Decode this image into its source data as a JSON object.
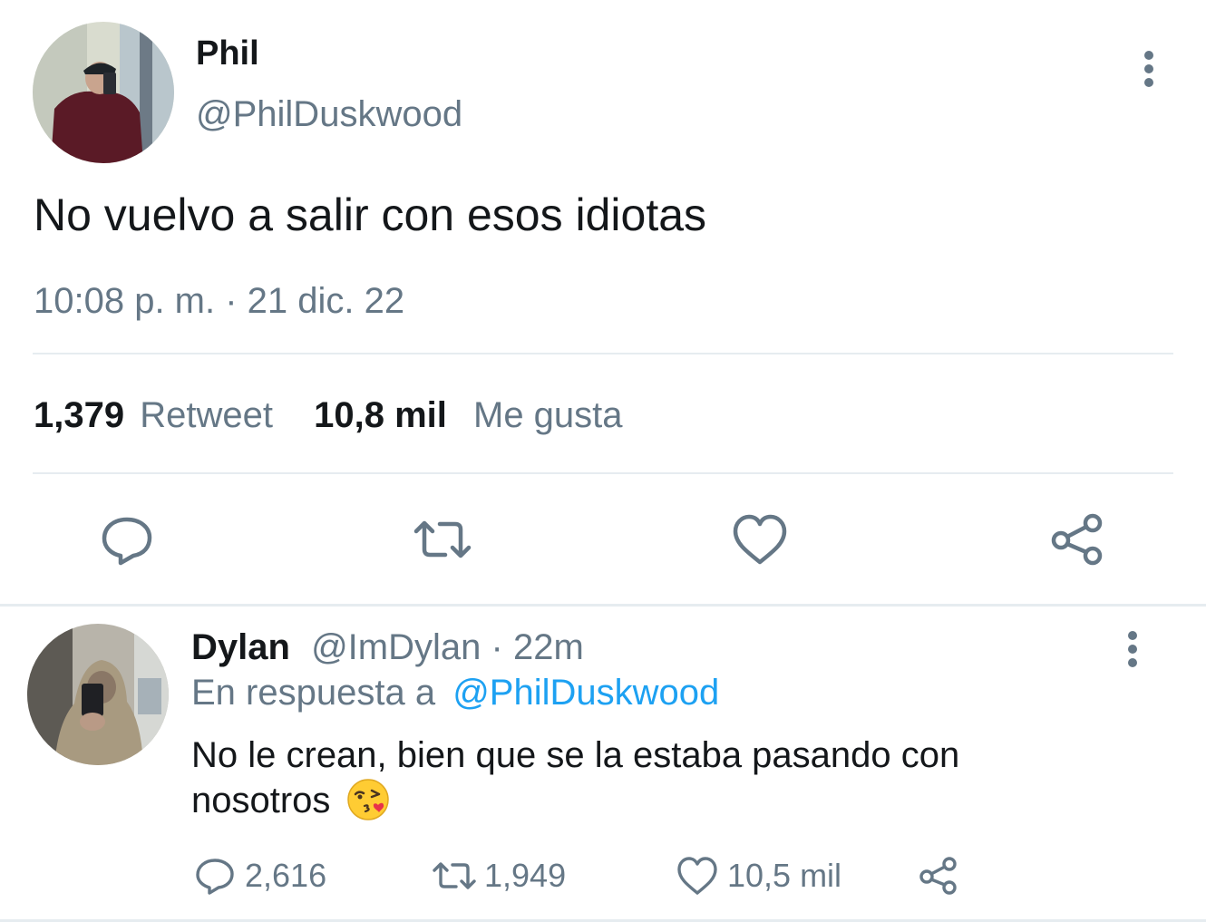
{
  "colors": {
    "text": "#14171a",
    "secondary": "#657786",
    "link": "#1da1f2",
    "divider": "#e6ecf0"
  },
  "main_tweet": {
    "author_name": "Phil",
    "author_handle": "@PhilDuskwood",
    "text": "No vuelvo a salir con esos idiotas",
    "timestamp": "10:08 p. m. · 21 dic. 22",
    "stats": {
      "retweets_count": "1,379",
      "retweets_label": "Retweet",
      "likes_count": "10,8 mil",
      "likes_label": "Me gusta"
    },
    "actions": [
      "reply-icon",
      "retweet-icon",
      "heart-icon",
      "share-icon"
    ]
  },
  "reply_tweet": {
    "author_name": "Dylan",
    "author_handle": "@ImDylan",
    "time": "22m",
    "separator": "·",
    "replying_to_label": "En respuesta a",
    "replying_to_handle": "@PhilDuskwood",
    "text": "No le crean, bien que se la estaba pasando con nosotros",
    "emoji": "kissing-face-winking-emoji",
    "reply_count": "2,616",
    "retweet_count": "1,949",
    "like_count": "10,5 mil"
  }
}
